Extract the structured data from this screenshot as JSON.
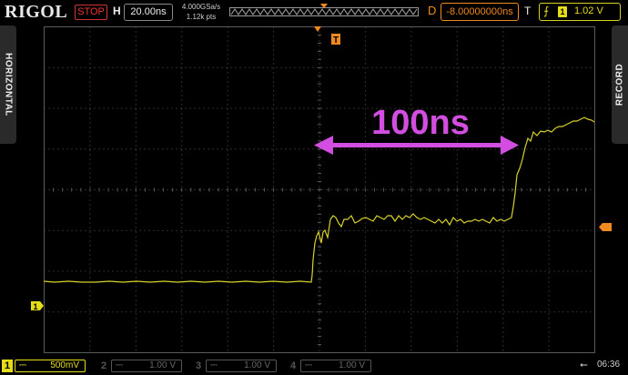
{
  "header": {
    "brand": "RIGOL",
    "run_state": "STOP",
    "horizontal_label": "H",
    "time_per_div": "20.00ns",
    "sample_rate": "4.000GSa/s",
    "memory_depth": "1.12k pts",
    "delay_label": "D",
    "delay_value": "-8.00000000ns",
    "trigger_label": "T",
    "trigger_source": "1",
    "trigger_level": "1.02 V"
  },
  "side_tabs": {
    "left": "HORIZONTAL",
    "right": "RECORD"
  },
  "annotation": {
    "text": "100ns",
    "color": "#d24ee0"
  },
  "markers": {
    "trigger_time": "T",
    "channel_ground": "1"
  },
  "channels": [
    {
      "number": "1",
      "coupling": "⎓",
      "scale": "500mV",
      "enabled": true
    },
    {
      "number": "2",
      "coupling": "⎓",
      "scale": "1.00 V",
      "enabled": false
    },
    {
      "number": "3",
      "coupling": "⎓",
      "scale": "1.00 V",
      "enabled": false
    },
    {
      "number": "4",
      "coupling": "⎓",
      "scale": "1.00 V",
      "enabled": false
    }
  ],
  "status": {
    "usb": "⭠",
    "clock": "06:36"
  },
  "colors": {
    "ch1": "#e6dd1a",
    "trigger": "#f08a1e",
    "stop": "#e33333",
    "annotation": "#d24ee0",
    "grid": "#5a5a5a"
  }
}
